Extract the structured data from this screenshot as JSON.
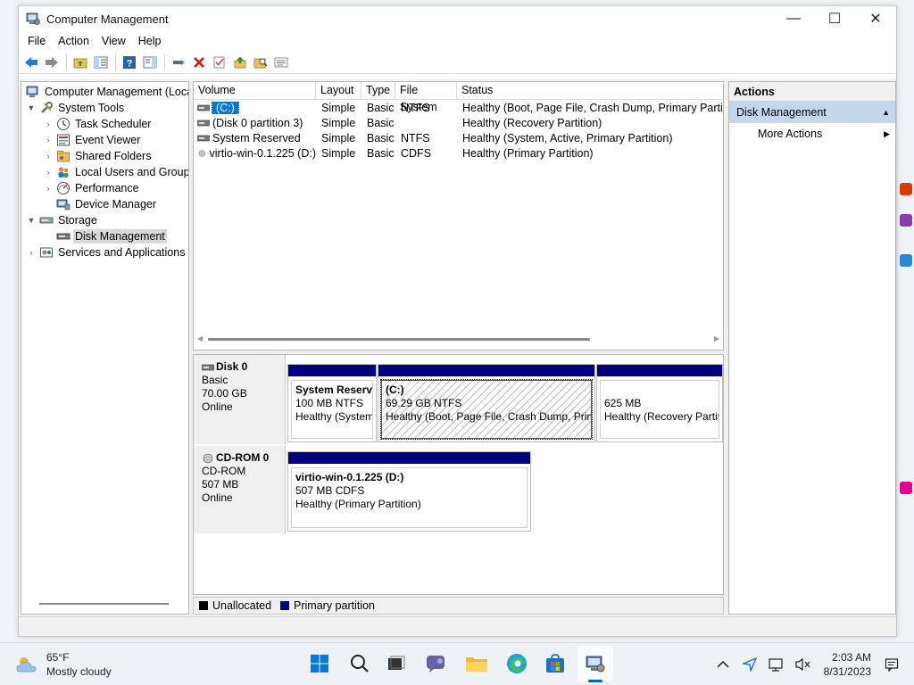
{
  "window": {
    "title": "Computer Management",
    "minimize_glyph": "—",
    "maximize_glyph": "☐",
    "close_glyph": "✕"
  },
  "menu": [
    "File",
    "Action",
    "View",
    "Help"
  ],
  "tree": {
    "root": "Computer Management (Local",
    "items": [
      {
        "label": "System Tools",
        "level": 1,
        "arrow": "▼",
        "icon": "tools-icon"
      },
      {
        "label": "Task Scheduler",
        "level": 2,
        "arrow": "›",
        "icon": "clock-icon"
      },
      {
        "label": "Event Viewer",
        "level": 2,
        "arrow": "›",
        "icon": "event-viewer-icon"
      },
      {
        "label": "Shared Folders",
        "level": 2,
        "arrow": "›",
        "icon": "shared-folder-icon"
      },
      {
        "label": "Local Users and Groups",
        "level": 2,
        "arrow": "›",
        "icon": "users-icon"
      },
      {
        "label": "Performance",
        "level": 2,
        "arrow": "›",
        "icon": "performance-icon"
      },
      {
        "label": "Device Manager",
        "level": 2,
        "arrow": "",
        "icon": "device-manager-icon"
      },
      {
        "label": "Storage",
        "level": 1,
        "arrow": "▼",
        "icon": "storage-icon"
      },
      {
        "label": "Disk Management",
        "level": 2,
        "arrow": "",
        "icon": "disk-management-icon",
        "selected": true
      },
      {
        "label": "Services and Applications",
        "level": 1,
        "arrow": "›",
        "icon": "services-icon"
      }
    ]
  },
  "volume_list": {
    "columns": [
      "Volume",
      "Layout",
      "Type",
      "File System",
      "Status"
    ],
    "rows": [
      {
        "volume": "(C:)",
        "layout": "Simple",
        "type": "Basic",
        "fs": "NTFS",
        "status": "Healthy (Boot, Page File, Crash Dump, Primary Partition",
        "selected": true
      },
      {
        "volume": "(Disk 0 partition 3)",
        "layout": "Simple",
        "type": "Basic",
        "fs": "",
        "status": "Healthy (Recovery Partition)"
      },
      {
        "volume": "System Reserved",
        "layout": "Simple",
        "type": "Basic",
        "fs": "NTFS",
        "status": "Healthy (System, Active, Primary Partition)"
      },
      {
        "volume": "virtio-win-0.1.225 (D:)",
        "layout": "Simple",
        "type": "Basic",
        "fs": "CDFS",
        "status": "Healthy (Primary Partition)"
      }
    ]
  },
  "disks": [
    {
      "name": "Disk 0",
      "kind": "Basic",
      "size": "70.00 GB",
      "state": "Online",
      "partitions": [
        {
          "name": "System Reserve",
          "detail": "100 MB NTFS",
          "status": "Healthy (System"
        },
        {
          "name": "(C:)",
          "detail": "69.29 GB NTFS",
          "status": "Healthy (Boot, Page File, Crash Dump, Prim"
        },
        {
          "name": "",
          "detail": "625 MB",
          "status": "Healthy (Recovery Partit"
        }
      ]
    },
    {
      "name": "CD-ROM 0",
      "kind": "CD-ROM",
      "size": "507 MB",
      "state": "Online",
      "partitions": [
        {
          "name": "virtio-win-0.1.225  (D:)",
          "detail": "507 MB CDFS",
          "status": "Healthy (Primary Partition)"
        }
      ]
    }
  ],
  "legend": [
    {
      "label": "Unallocated",
      "color": "#000000"
    },
    {
      "label": "Primary partition",
      "color": "#00007f"
    }
  ],
  "actions": {
    "title": "Actions",
    "section": "Disk Management",
    "more": "More Actions"
  },
  "taskbar": {
    "weather_temp": "65°F",
    "weather_desc": "Mostly cloudy",
    "time": "2:03 AM",
    "date": "8/31/2023"
  },
  "colors": {
    "primary_partition": "#00007f",
    "selection": "#0078d7",
    "actions_header": "#c3d7eb"
  }
}
